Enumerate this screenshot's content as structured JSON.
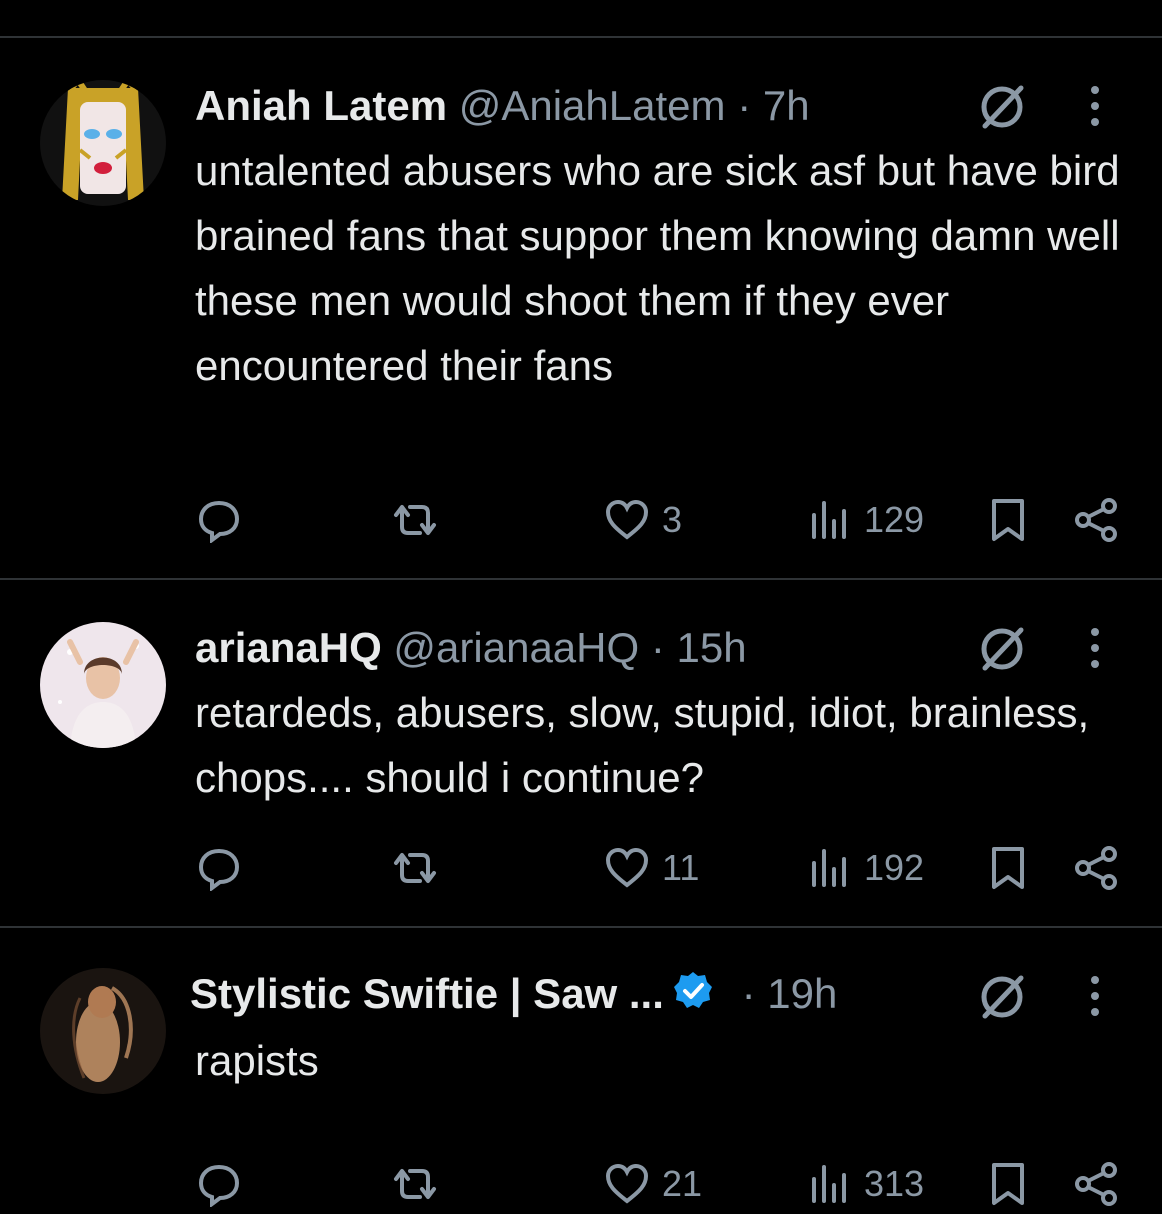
{
  "colors": {
    "background": "#000000",
    "text": "#e7e9ea",
    "muted": "#8b98a5",
    "divider": "#2f3336",
    "verified": "#1d9bf0"
  },
  "tweets": [
    {
      "name": "Aniah Latem",
      "handle": "@AniahLatem",
      "dot": "·",
      "time": "7h",
      "text": "untalented abusers who are sick asf but have bird brained fans that suppor them knowing damn well these men would shoot them if they ever encountered their fans",
      "likes": "3",
      "views": "129",
      "verified": false
    },
    {
      "name": "arianaHQ",
      "handle": "@arianaaHQ",
      "dot": "·",
      "time": "15h",
      "text": "retardeds, abusers, slow, stupid, idiot, brainless, chops.... should i continue?",
      "likes": "11",
      "views": "192",
      "verified": false
    },
    {
      "name": "Stylistic Swiftie | Saw ...",
      "handle": "",
      "dot": "·",
      "time": "19h",
      "text": "rapists",
      "likes": "21",
      "views": "313",
      "verified": true
    }
  ],
  "icons": [
    "reply-icon",
    "retweet-icon",
    "like-icon",
    "views-icon",
    "bookmark-icon",
    "share-icon",
    "grok-icon",
    "more-icon",
    "verified-icon"
  ]
}
